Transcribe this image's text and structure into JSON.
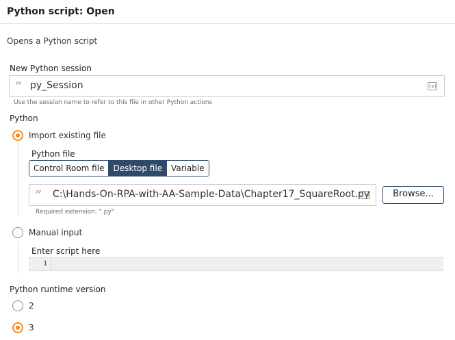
{
  "header": {
    "title": "Python script: Open",
    "description": "Opens a Python script"
  },
  "session": {
    "label": "New Python session",
    "value": "py_Session",
    "var_icon": "(x)",
    "help": "Use the session name to refer to this file in other Python actions"
  },
  "python": {
    "label": "Python",
    "options": [
      {
        "label": "Import existing file",
        "selected": true
      },
      {
        "label": "Manual input",
        "selected": false
      }
    ],
    "file": {
      "label": "Python file",
      "tabs": [
        "Control Room file",
        "Desktop file",
        "Variable"
      ],
      "active_tab": "Desktop file",
      "path": "C:\\Hands-On-RPA-with-AA-Sample-Data\\Chapter17_SquareRoot.py",
      "var_icon": "(x)",
      "browse_label": "Browse...",
      "help": "Required extension: \".py\""
    },
    "script": {
      "label": "Enter script here",
      "line_number": "1"
    }
  },
  "runtime": {
    "label": "Python runtime version",
    "options": [
      {
        "label": "2",
        "selected": false
      },
      {
        "label": "3",
        "selected": true
      }
    ]
  },
  "colors": {
    "accent": "#f58a1f",
    "navy": "#2f4a6b"
  },
  "icons": {
    "quote": "quote-icon",
    "variable": "variable-icon"
  }
}
